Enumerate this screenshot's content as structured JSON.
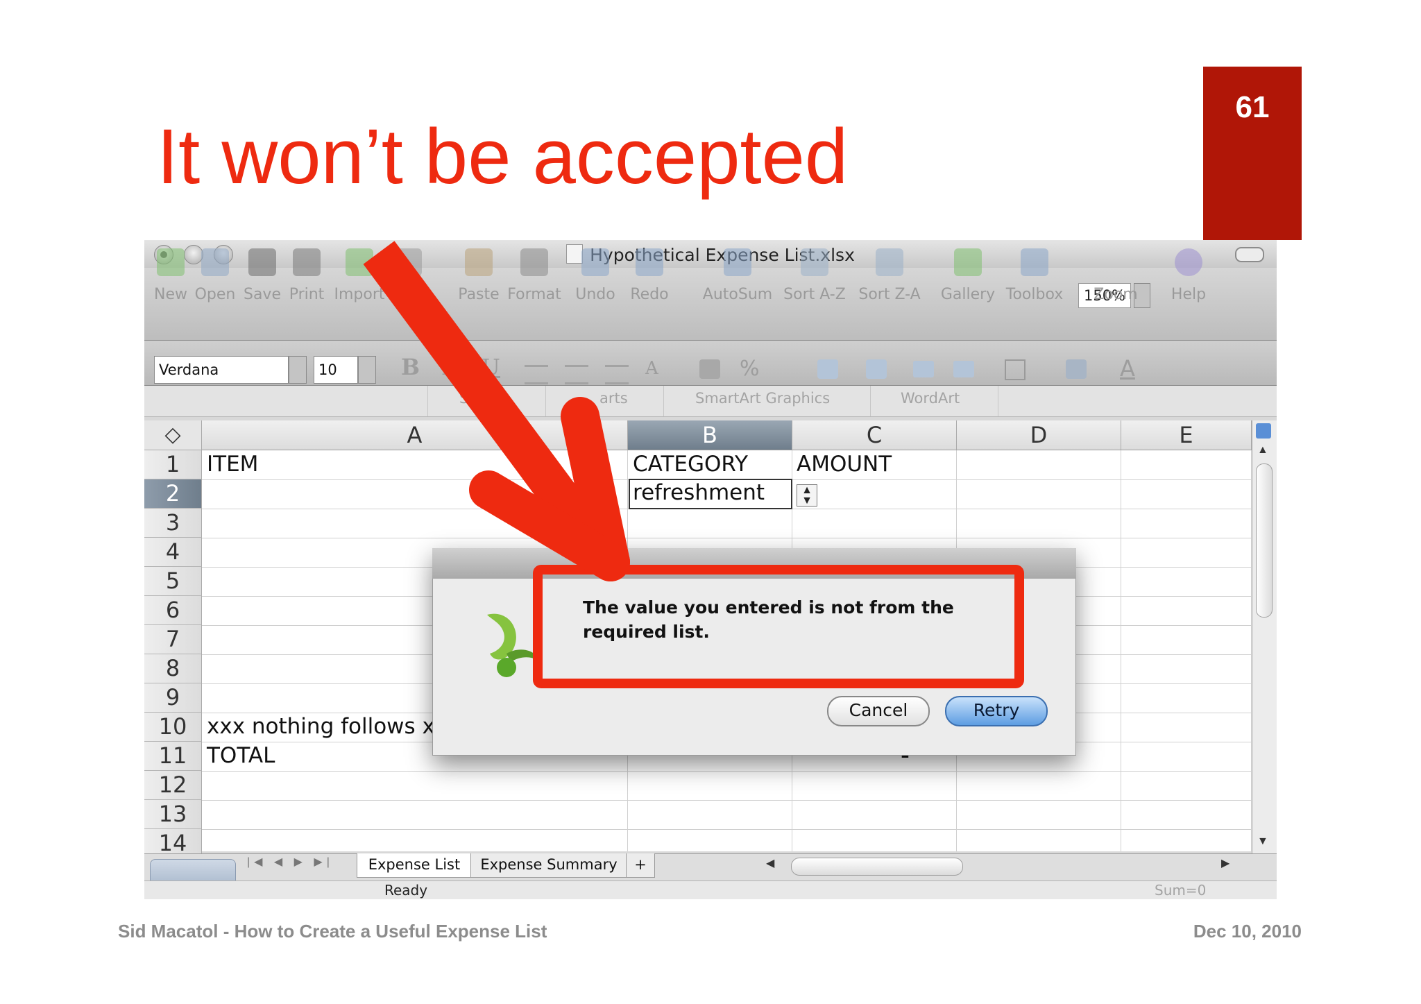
{
  "slide": {
    "title": "It won’t be accepted",
    "page_number": "61",
    "footer_left": "Sid Macatol - How to Create a Useful Expense List",
    "footer_right": "Dec 10, 2010"
  },
  "window": {
    "title": "Hypothetical Expense List.xlsx"
  },
  "toolbar": {
    "buttons": [
      "New",
      "Open",
      "Save",
      "Print",
      "Import",
      "C",
      "Paste",
      "Format",
      "Undo",
      "Redo",
      "AutoSum",
      "Sort A-Z",
      "Sort Z-A",
      "Gallery",
      "Toolbox",
      "Zoom",
      "Help"
    ],
    "zoom_value": "150%"
  },
  "format_bar": {
    "font": "Verdana",
    "size": "10",
    "glyphs": [
      "B",
      "I",
      "U",
      "A",
      "%",
      "A"
    ]
  },
  "ribbon": {
    "tabs": [
      "Sh",
      "arts",
      "SmartArt Graphics",
      "WordArt"
    ]
  },
  "grid": {
    "corner": "◇",
    "columns": [
      "A",
      "B",
      "C",
      "D",
      "E"
    ],
    "selected_column": "B",
    "rows": [
      "1",
      "2",
      "3",
      "4",
      "5",
      "6",
      "7",
      "8",
      "9",
      "10",
      "11",
      "12",
      "13",
      "14"
    ],
    "selected_row": "2",
    "cells": {
      "a1": "ITEM",
      "b1": "CATEGORY",
      "c1": "AMOUNT",
      "b2": "refreshment",
      "a10": "xxx nothing follows x",
      "a11": "TOTAL",
      "c11": "-"
    }
  },
  "sheets": {
    "tabs": [
      "Expense List",
      "Expense Summary",
      "+"
    ],
    "active": "Expense List"
  },
  "status": {
    "ready": "Ready",
    "sum": "Sum=0"
  },
  "dialog": {
    "message": "The value you entered is not from the required list.",
    "cancel_label": "Cancel",
    "retry_label": "Retry"
  },
  "colors": {
    "accent_red": "#ee2a10",
    "page_box": "#b01607",
    "retry_blue": "#5d9de2"
  }
}
